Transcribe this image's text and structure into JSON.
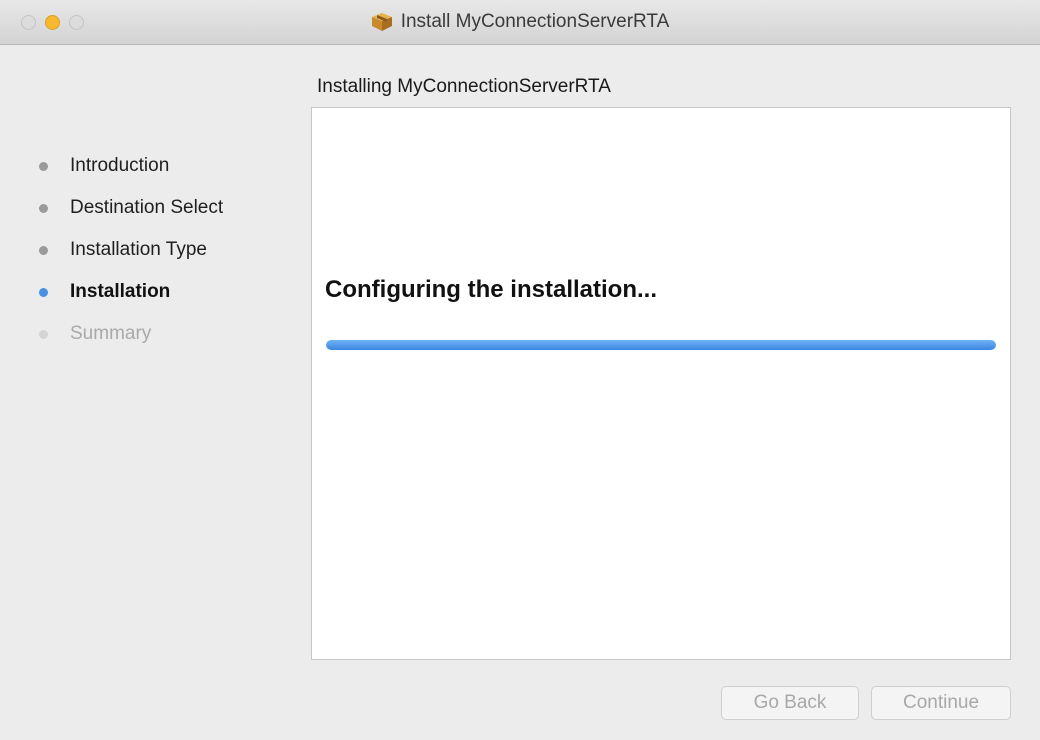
{
  "window": {
    "title": "Install MyConnectionServerRTA",
    "title_icon": "package-icon"
  },
  "heading": "Installing MyConnectionServerRTA",
  "sidebar": {
    "steps": [
      {
        "label": "Introduction",
        "state": "done"
      },
      {
        "label": "Destination Select",
        "state": "done"
      },
      {
        "label": "Installation Type",
        "state": "done"
      },
      {
        "label": "Installation",
        "state": "current"
      },
      {
        "label": "Summary",
        "state": "pending"
      }
    ]
  },
  "main": {
    "status_text": "Configuring the installation...",
    "progress": 1.0
  },
  "buttons": {
    "back_label": "Go Back",
    "continue_label": "Continue"
  },
  "colors": {
    "accent": "#4a90e2",
    "minimize": "#f5b82e",
    "done_dot": "#9a9a9a",
    "pending_dot": "#d4d4d4"
  }
}
